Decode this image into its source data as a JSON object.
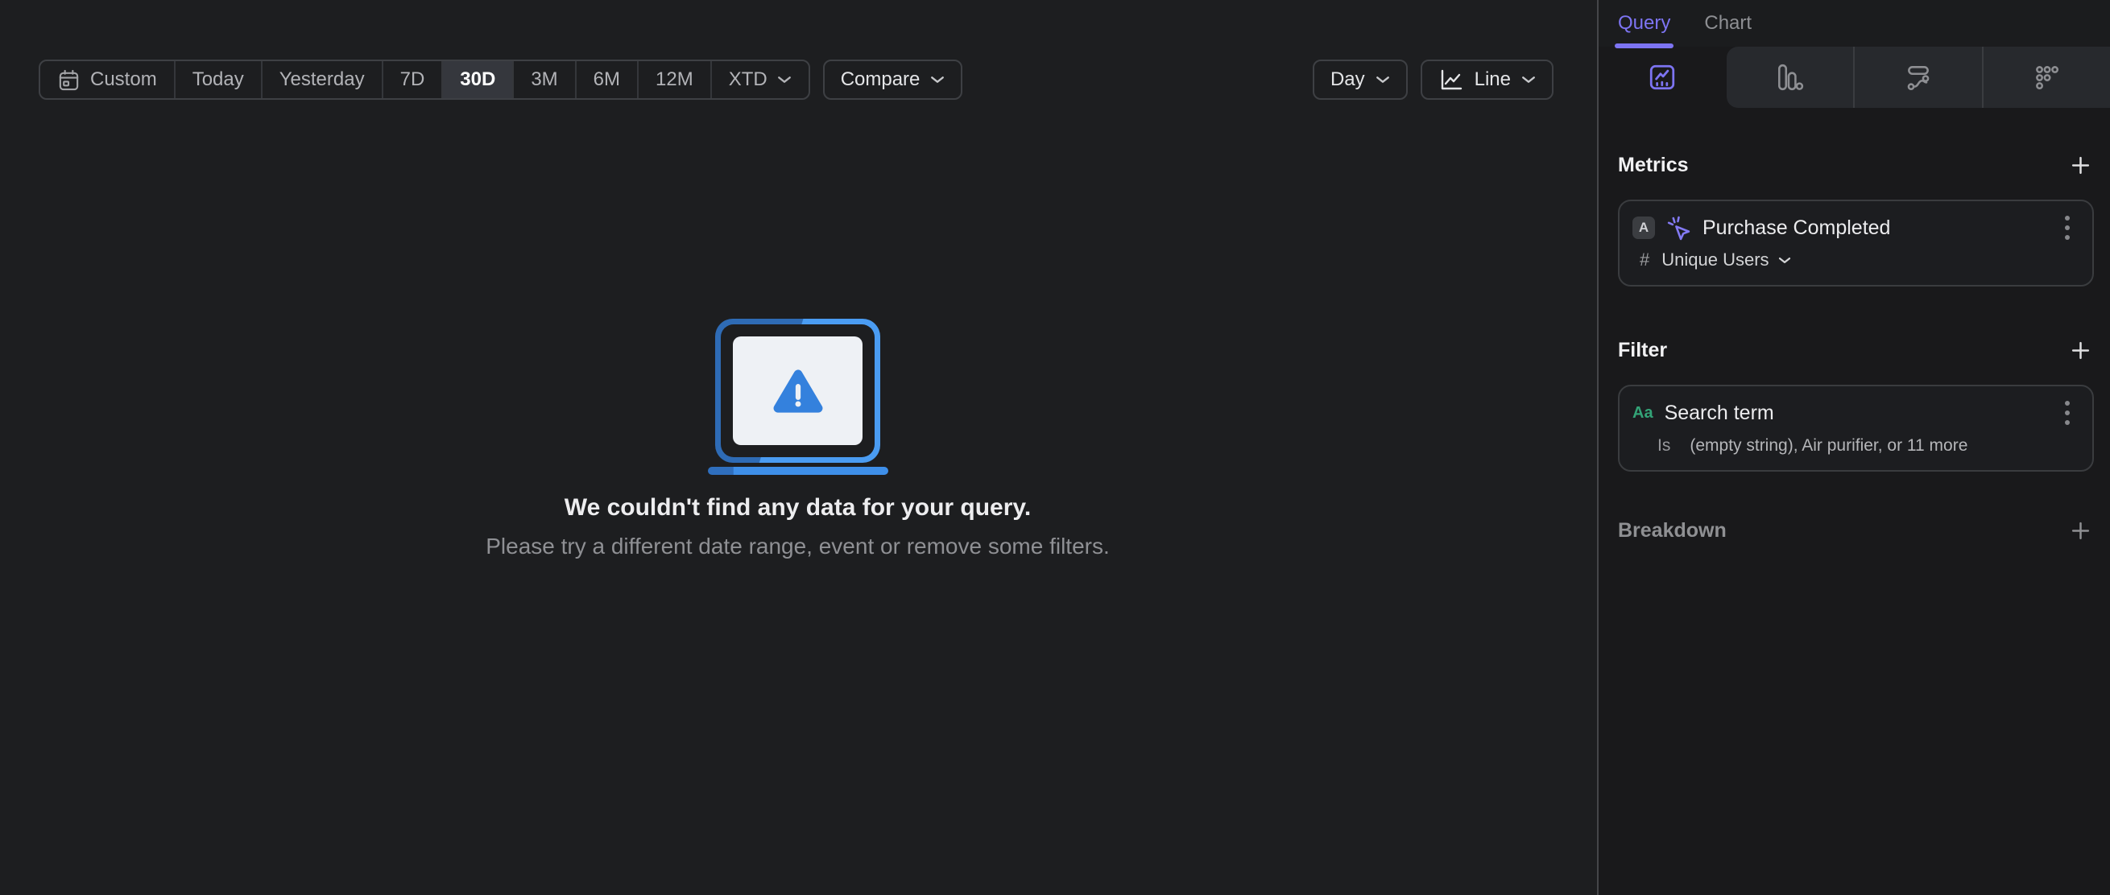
{
  "toolbar": {
    "date_ranges": {
      "custom": "Custom",
      "today": "Today",
      "yesterday": "Yesterday",
      "d7": "7D",
      "d30": "30D",
      "m3": "3M",
      "m6": "6M",
      "m12": "12M",
      "xtd": "XTD"
    },
    "selected_range": "30D",
    "compare_label": "Compare",
    "granularity": {
      "label": "Day"
    },
    "chart_type": {
      "label": "Line",
      "icon": "line-chart-icon"
    }
  },
  "empty_state": {
    "title": "We couldn't find any data for your query.",
    "subtitle": "Please try a different date range, event or remove some filters.",
    "icon": "monitor-warning-illustration"
  },
  "sidebar": {
    "tabs": {
      "query": "Query",
      "chart": "Chart",
      "active": "Query"
    },
    "view_tabs": [
      "insights-icon",
      "bar-chart-icon",
      "flows-icon",
      "retention-dots-icon"
    ],
    "active_view_tab": "insights-icon",
    "metrics": {
      "heading": "Metrics",
      "items": [
        {
          "badge": "A",
          "icon": "event-cursor-icon",
          "title": "Purchase Completed",
          "aggregation_symbol": "#",
          "aggregation": "Unique Users"
        }
      ]
    },
    "filter": {
      "heading": "Filter",
      "items": [
        {
          "type_badge": "Aa",
          "title": "Search term",
          "operator": "Is",
          "value": "(empty string), Air purifier, or 11 more"
        }
      ]
    },
    "breakdown": {
      "heading": "Breakdown"
    }
  },
  "colors": {
    "accent_purple": "#7D74F2",
    "illustration_blue": "#3E8FE9",
    "warning_triangle_blue": "#3481DD",
    "string_green": "#33A377",
    "selected_segment_bg": "#35373D"
  }
}
